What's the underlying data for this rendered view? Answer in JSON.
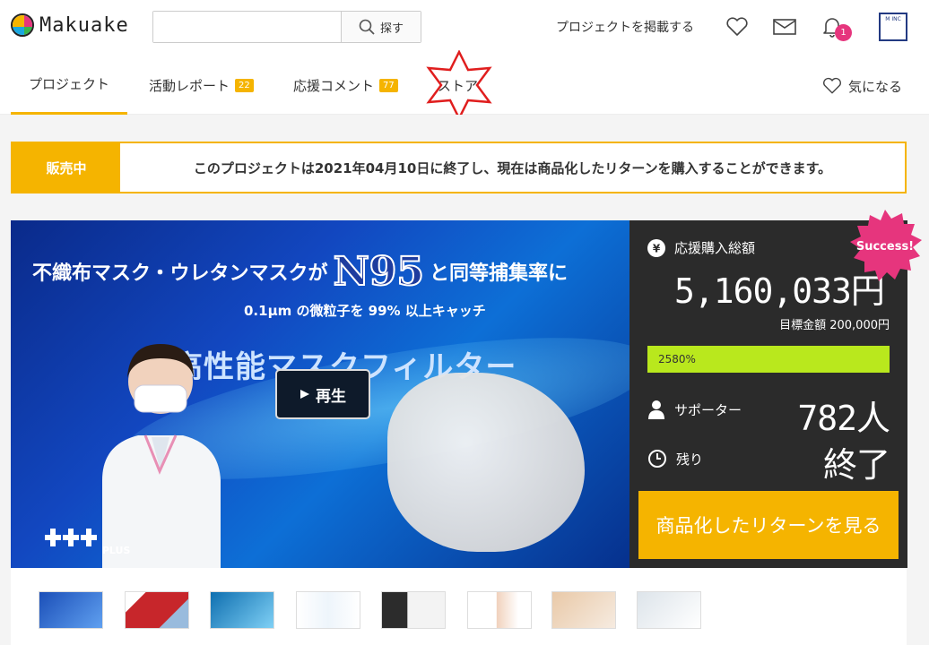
{
  "header": {
    "logo": "Makuake",
    "search_placeholder": "",
    "search_button": "探す",
    "post_project": "プロジェクトを掲載する",
    "notification_count": "1",
    "company_badge_text": "M INC"
  },
  "tabs": [
    {
      "label": "プロジェクト",
      "count": ""
    },
    {
      "label": "活動レポート",
      "count": "22"
    },
    {
      "label": "応援コメント",
      "count": "77"
    },
    {
      "label": "ストア",
      "count": ""
    }
  ],
  "favorite_label": "気になる",
  "notice": {
    "label": "販売中",
    "message": "このプロジェクトは2021年04月10日に終了し、現在は商品化したリターンを購入することができます。"
  },
  "hero": {
    "line1_before": "不織布マスク・ウレタンマスクが",
    "line1_highlight": "N95",
    "line1_after": "と同等捕集率に",
    "line2": "0.1μm の微粒子を 99% 以上キャッチ",
    "line3": "高性能マスクフィルター",
    "brand": "PLUS",
    "play_label": "再生"
  },
  "stats": {
    "total_label": "応援購入総額",
    "total_amount": "5,160,033円",
    "goal": "目標金額 200,000円",
    "percent_label": "2580%",
    "supporters_label": "サポーター",
    "supporters_value": "782人",
    "remaining_label": "残り",
    "remaining_value": "終了",
    "cta": "商品化したリターンを見る",
    "success_badge": "Success!"
  },
  "colors": {
    "accent": "#f5b400",
    "progress": "#b9e81d",
    "notif": "#e6357d",
    "success": "#e6357d",
    "dark_panel": "#2b2b2b"
  },
  "thumbnails": [
    {
      "name": "thumb-1"
    },
    {
      "name": "thumb-2"
    },
    {
      "name": "thumb-3"
    },
    {
      "name": "thumb-4"
    },
    {
      "name": "thumb-5"
    },
    {
      "name": "thumb-6"
    },
    {
      "name": "thumb-7"
    },
    {
      "name": "thumb-8"
    }
  ]
}
